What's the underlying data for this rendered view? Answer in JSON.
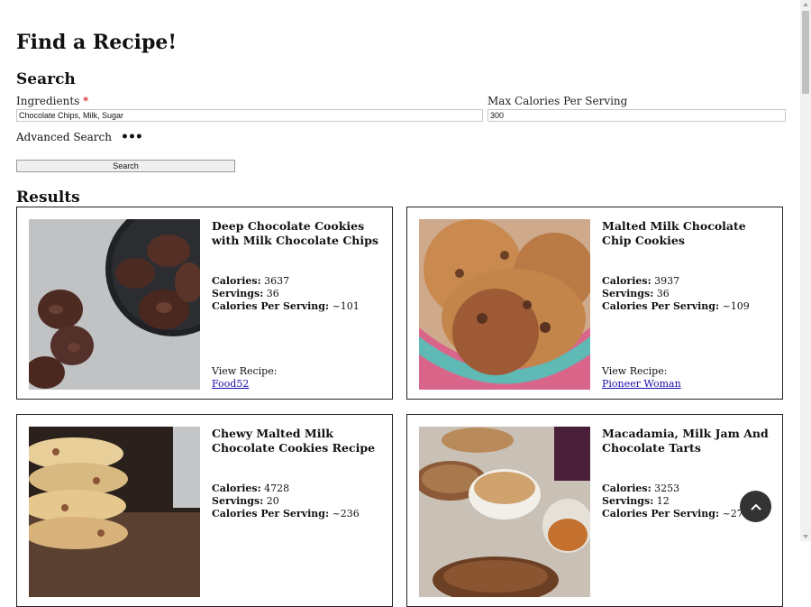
{
  "page": {
    "title": "Find a Recipe!"
  },
  "search": {
    "heading": "Search",
    "ingredients_label": "Ingredients",
    "required_mark": "*",
    "ingredients_value": "Chocolate Chips, Milk, Sugar",
    "max_calories_label": "Max Calories Per Serving",
    "max_calories_value": "300",
    "advanced_label": "Advanced Search",
    "advanced_icon": "•••",
    "button_label": "Search"
  },
  "results": {
    "heading": "Results",
    "labels": {
      "calories": "Calories:",
      "servings": "Servings:",
      "per_serving": "Calories Per Serving:",
      "view": "View Recipe:"
    },
    "cards": [
      {
        "title": "Deep Chocolate Cookies with Milk Chocolate Chips",
        "calories": "3637",
        "servings": "36",
        "per_serving": "~101",
        "source": "Food52"
      },
      {
        "title": "Malted Milk Chocolate Chip Cookies",
        "calories": "3937",
        "servings": "36",
        "per_serving": "~109",
        "source": "Pioneer Woman"
      },
      {
        "title": "Chewy Malted Milk Chocolate Cookies Recipe",
        "calories": "4728",
        "servings": "20",
        "per_serving": "~236",
        "source": ""
      },
      {
        "title": "Macadamia, Milk Jam And Chocolate Tarts",
        "calories": "3253",
        "servings": "12",
        "per_serving": "~271",
        "source": ""
      }
    ]
  },
  "fab": {
    "icon": "chevron-up-icon"
  },
  "colors": {
    "link": "#1a0dab",
    "required": "#dd0000",
    "fab": "#333333"
  }
}
